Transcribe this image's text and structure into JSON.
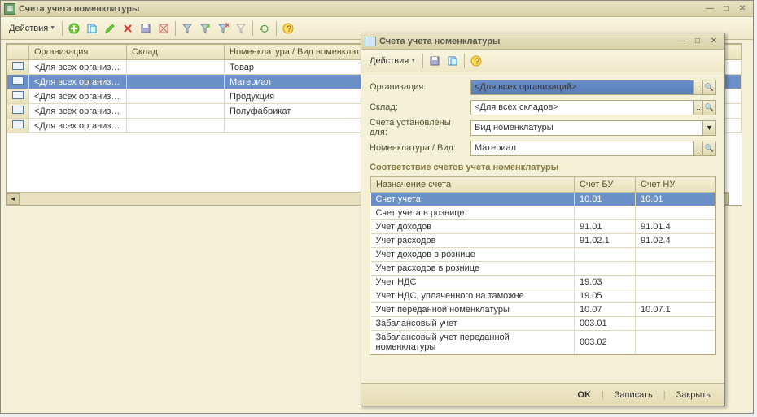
{
  "main": {
    "title": "Счета учета номенклатуры",
    "toolbar": {
      "actions": "Действия"
    },
    "grid": {
      "headers": [
        "Организация",
        "Склад",
        "Номенклатура / Вид номенклатуры"
      ],
      "rows": [
        {
          "org": "<Для всех организ…",
          "sklad": "",
          "nom": "Товар",
          "sel": false
        },
        {
          "org": "<Для всех организ…",
          "sklad": "",
          "nom": "Материал",
          "sel": true
        },
        {
          "org": "<Для всех организ…",
          "sklad": "",
          "nom": "Продукция",
          "sel": false
        },
        {
          "org": "<Для всех организ…",
          "sklad": "",
          "nom": "Полуфабрикат",
          "sel": false
        },
        {
          "org": "<Для всех организ…",
          "sklad": "",
          "nom": "",
          "sel": false
        }
      ]
    }
  },
  "dialog": {
    "title": "Счета учета номенклатуры",
    "toolbar": {
      "actions": "Действия"
    },
    "form": {
      "org_label": "Организация:",
      "org_val": "<Для всех организаций>",
      "sklad_label": "Склад:",
      "sklad_val": "<Для всех складов>",
      "ustfor_label": "Счета установлены для:",
      "ustfor_val": "Вид номенклатуры",
      "nom_label": "Номенклатура / Вид:",
      "nom_val": "Материал"
    },
    "section": "Соответствие счетов учета номенклатуры",
    "sub_headers": [
      "Назначение счета",
      "Счет БУ",
      "Счет НУ"
    ],
    "sub_rows": [
      {
        "n": "Счет учета",
        "bu": "10.01",
        "nu": "10.01",
        "sel": true
      },
      {
        "n": "Счет учета в рознице",
        "bu": "",
        "nu": ""
      },
      {
        "n": "Учет доходов",
        "bu": "91.01",
        "nu": "91.01.4"
      },
      {
        "n": "Учет расходов",
        "bu": "91.02.1",
        "nu": "91.02.4"
      },
      {
        "n": "Учет доходов в рознице",
        "bu": "",
        "nu": ""
      },
      {
        "n": "Учет расходов в рознице",
        "bu": "",
        "nu": ""
      },
      {
        "n": "Учет НДС",
        "bu": "19.03",
        "nu": ""
      },
      {
        "n": "Учет НДС, уплаченного на таможне",
        "bu": "19.05",
        "nu": ""
      },
      {
        "n": "Учет переданной номенклатуры",
        "bu": "10.07",
        "nu": "10.07.1"
      },
      {
        "n": "Забалансовый учет",
        "bu": "003.01",
        "nu": ""
      },
      {
        "n": "Забалансовый учет переданной номенклатуры",
        "bu": "003.02",
        "nu": ""
      }
    ],
    "buttons": {
      "ok": "OK",
      "save": "Записать",
      "close": "Закрыть"
    }
  }
}
